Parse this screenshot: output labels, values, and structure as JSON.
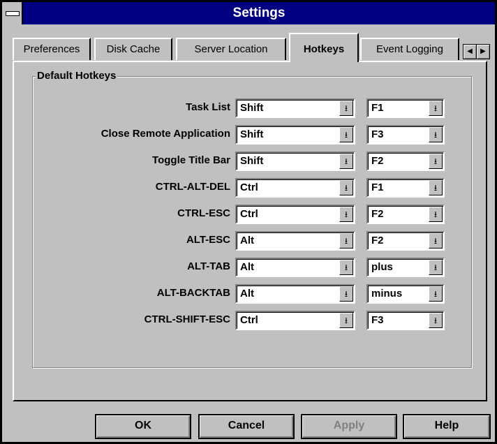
{
  "window": {
    "title": "Settings"
  },
  "tabs": [
    {
      "label": "Preferences",
      "active": false
    },
    {
      "label": "Disk Cache",
      "active": false
    },
    {
      "label": "Server Location",
      "active": false
    },
    {
      "label": "Hotkeys",
      "active": true
    },
    {
      "label": "Event Logging",
      "active": false
    }
  ],
  "tab_scroll": {
    "left_icon": "scroll-left-arrow",
    "right_icon": "scroll-right-arrow"
  },
  "group": {
    "title": "Default Hotkeys"
  },
  "hotkeys": [
    {
      "label": "Task List",
      "modifier": "Shift",
      "key": "F1"
    },
    {
      "label": "Close Remote Application",
      "modifier": "Shift",
      "key": "F3"
    },
    {
      "label": "Toggle Title Bar",
      "modifier": "Shift",
      "key": "F2"
    },
    {
      "label": "CTRL-ALT-DEL",
      "modifier": "Ctrl",
      "key": "F1"
    },
    {
      "label": "CTRL-ESC",
      "modifier": "Ctrl",
      "key": "F2"
    },
    {
      "label": "ALT-ESC",
      "modifier": "Alt",
      "key": "F2"
    },
    {
      "label": "ALT-TAB",
      "modifier": "Alt",
      "key": "plus"
    },
    {
      "label": "ALT-BACKTAB",
      "modifier": "Alt",
      "key": "minus"
    },
    {
      "label": "CTRL-SHIFT-ESC",
      "modifier": "Ctrl",
      "key": "F3"
    }
  ],
  "buttons": {
    "ok": "OK",
    "cancel": "Cancel",
    "apply": "Apply",
    "help": "Help"
  },
  "colors": {
    "titlebar": "#000080",
    "face": "#c0c0c0"
  }
}
